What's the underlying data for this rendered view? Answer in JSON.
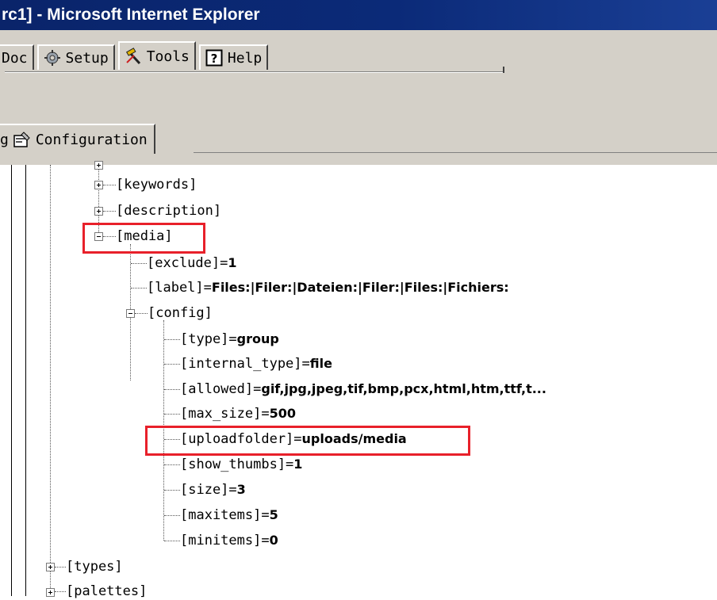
{
  "window": {
    "title": "rc1] - Microsoft Internet Explorer"
  },
  "menu_tabs": [
    {
      "label": "Doc",
      "icon": "none"
    },
    {
      "label": "Setup",
      "icon": "setup-gear-icon"
    },
    {
      "label": "Tools",
      "icon": "tools-hammer-icon"
    },
    {
      "label": "Help",
      "icon": "help-question-icon"
    }
  ],
  "sub_tab": {
    "prefix": "g",
    "label": "Configuration",
    "icon": "configuration-icon"
  },
  "tree": {
    "keywords": "[keywords]",
    "description": "[description]",
    "media": "[media]",
    "exclude": {
      "key": "[exclude]=",
      "value": "1"
    },
    "label": {
      "key": "[label]=",
      "value": "Files:|Filer:|Dateien:|Filer:|Files:|Fichiers:"
    },
    "config": "[config]",
    "type": {
      "key": "[type]=",
      "value": "group"
    },
    "internal_type": {
      "key": "[internal_type]=",
      "value": "file"
    },
    "allowed": {
      "key": "[allowed]=",
      "value": "gif,jpg,jpeg,tif,bmp,pcx,html,htm,ttf,t..."
    },
    "max_size": {
      "key": "[max_size]=",
      "value": "500"
    },
    "uploadfolder": {
      "key": "[uploadfolder]=",
      "value": "uploads/media"
    },
    "show_thumbs": {
      "key": "[show_thumbs]=",
      "value": "1"
    },
    "size": {
      "key": "[size]=",
      "value": "3"
    },
    "maxitems": {
      "key": "[maxitems]=",
      "value": "5"
    },
    "minitems": {
      "key": "[minitems]=",
      "value": "0"
    },
    "types": "[types]",
    "palettes": "[palettes]"
  },
  "highlight_color": "#e8202a"
}
